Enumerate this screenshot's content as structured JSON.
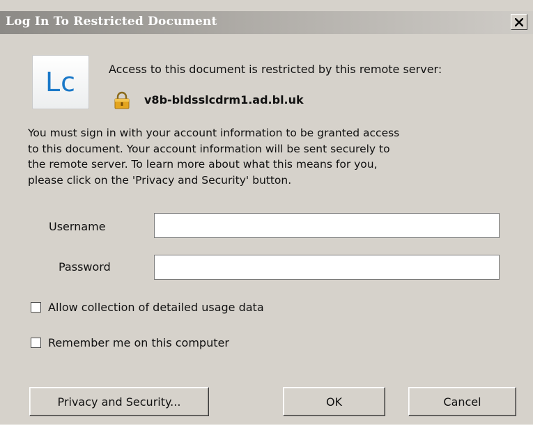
{
  "window": {
    "title": "Log In To Restricted Document",
    "close_symbol": "x"
  },
  "app_icon": {
    "label": "Lc",
    "color": "#1a78c8"
  },
  "header": {
    "access_message": "Access to this document is restricted by this remote server:",
    "server_name": "v8b-bldsslcdrm1.ad.bl.uk",
    "lock_icon": "lock-icon"
  },
  "info": {
    "lines": [
      "You must sign in with your account information to be granted access",
      "to this document. Your account information will be sent securely to",
      "the remote server. To learn more about what this means for you,",
      "please click on the 'Privacy and Security' button."
    ]
  },
  "form": {
    "username_label": "Username",
    "username_value": "",
    "password_label": "Password",
    "password_value": ""
  },
  "options": {
    "usage_data_label": "Allow collection of detailed usage data",
    "usage_data_checked": false,
    "remember_label": "Remember me on this computer",
    "remember_checked": false
  },
  "buttons": {
    "privacy": "Privacy and Security...",
    "ok": "OK",
    "cancel": "Cancel"
  }
}
